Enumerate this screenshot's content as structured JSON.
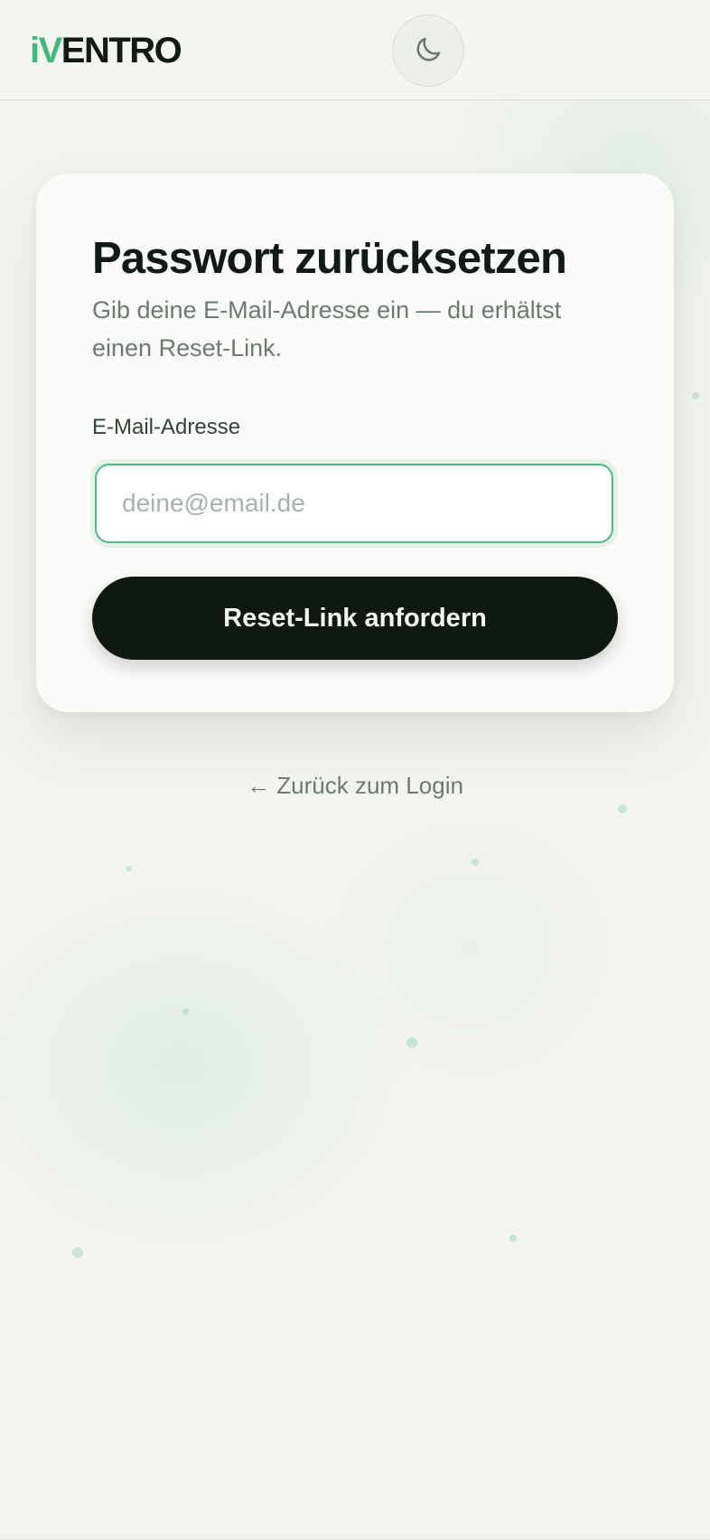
{
  "header": {
    "logo_accent": "iV",
    "logo_rest": "ENTRO",
    "theme_toggle_icon": "moon-icon"
  },
  "card": {
    "title": "Passwort zurücksetzen",
    "subtitle": "Gib deine E-Mail-Adresse ein — du erhältst einen Reset-Link.",
    "email_label": "E-Mail-Adresse",
    "email_value": "",
    "email_placeholder": "deine@email.de",
    "submit_label": "Reset-Link anfordern"
  },
  "back_link": "← Zurück zum Login",
  "colors": {
    "accent": "#3fb87c",
    "primary_button": "#101812",
    "background": "#f3f4ef",
    "card": "#fafaf8"
  }
}
